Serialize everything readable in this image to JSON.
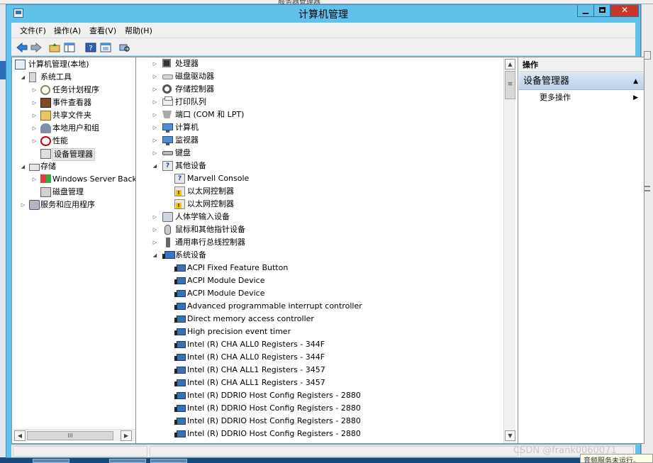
{
  "background": {
    "top_window_title": "服务器管理器",
    "status_text": "音频服务未运行。",
    "watermark": "CSDN @frank0060071"
  },
  "window": {
    "title": "计算机管理",
    "controls": {
      "minimize": "▁",
      "close": "✕"
    }
  },
  "menu": [
    "文件(F)",
    "操作(A)",
    "查看(V)",
    "帮助(H)"
  ],
  "toolbar": [
    {
      "name": "back-icon",
      "glyph": "⇦"
    },
    {
      "name": "forward-icon",
      "glyph": "⇨"
    },
    {
      "name": "up-folder-icon",
      "glyph": "⬆"
    },
    {
      "name": "show-hide-tree-icon",
      "glyph": "▤"
    },
    {
      "name": "help-icon",
      "glyph": "?"
    },
    {
      "name": "properties-icon",
      "glyph": "▦"
    },
    {
      "name": "scan-hardware-icon",
      "glyph": "⌕"
    }
  ],
  "tree": {
    "root": "计算机管理(本地)",
    "system_tools": "系统工具",
    "task_scheduler": "任务计划程序",
    "event_viewer": "事件查看器",
    "shared_folders": "共享文件夹",
    "local_users": "本地用户和组",
    "performance": "性能",
    "device_manager": "设备管理器",
    "storage": "存储",
    "windows_server_backup": "Windows Server Back",
    "disk_management": "磁盘管理",
    "services_apps": "服务和应用程序",
    "hscroll_grip": "III"
  },
  "devices": {
    "processors": "处理器",
    "disk_drives": "磁盘驱动器",
    "storage_controllers": "存储控制器",
    "print_queues": "打印队列",
    "ports": "端口 (COM 和 LPT)",
    "computer": "计算机",
    "monitors": "监视器",
    "keyboards": "键盘",
    "other_devices": "其他设备",
    "other_children": [
      "Marvell Console",
      "以太网控制器",
      "以太网控制器"
    ],
    "hid": "人体学输入设备",
    "mice": "鼠标和其他指针设备",
    "usb": "通用串行总线控制器",
    "system_devices": "系统设备",
    "system_children": [
      "ACPI Fixed Feature Button",
      "ACPI Module Device",
      "ACPI Module Device",
      "Advanced programmable interrupt controller",
      "Direct memory access controller",
      "High precision event timer",
      "Intel (R) CHA ALL0 Registers - 344F",
      "Intel (R) CHA ALL0 Registers - 344F",
      "Intel (R) CHA ALL1 Registers - 3457",
      "Intel (R) CHA ALL1 Registers - 3457",
      "Intel (R) DDRIO Host Config Registers - 2880",
      "Intel (R) DDRIO Host Config Registers - 2880",
      "Intel (R) DDRIO Host Config Registers - 2880",
      "Intel (R) DDRIO Host Config Registers - 2880"
    ],
    "vscroll_grip": "≡"
  },
  "actions": {
    "header": "操作",
    "section": "设备管理器",
    "more": "更多操作"
  },
  "colors": {
    "title_bar": "#60c1ea",
    "close_button": "#c7372b",
    "pane_background": "#ffffff",
    "chrome": "#f0f0f0"
  }
}
